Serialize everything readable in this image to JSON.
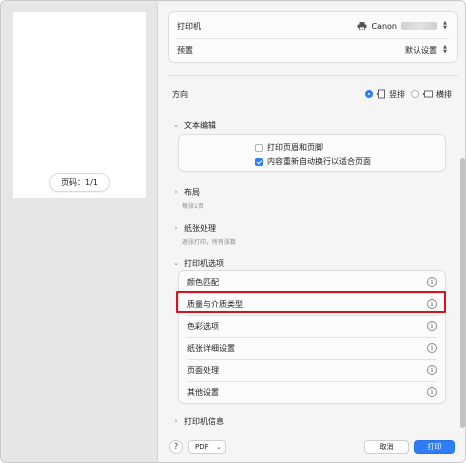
{
  "preview": {
    "page_indicator": "页码：1/1"
  },
  "top_card": {
    "printer_label": "打印机",
    "printer_value": "Canon",
    "preset_label": "预置",
    "preset_value": "默认设置"
  },
  "orientation": {
    "label": "方向",
    "options": [
      "竖排",
      "横排"
    ],
    "selected": "竖排"
  },
  "text_edit": {
    "title": "文本编辑",
    "options": [
      {
        "label": "打印页眉和页脚",
        "checked": false
      },
      {
        "label": "内容重新自动换行以适合页面",
        "checked": true
      }
    ]
  },
  "layout": {
    "title": "布局",
    "summary": "每张1页"
  },
  "paper_handling": {
    "title": "纸张处理",
    "summary": "逐张打印，所有张数"
  },
  "printer_options": {
    "title": "打印机选项",
    "items": [
      "颜色匹配",
      "质量与介质类型",
      "色彩选项",
      "纸张详细设置",
      "页面处理",
      "其他设置"
    ],
    "highlighted": "质量与介质类型"
  },
  "printer_info": {
    "title": "打印机信息"
  },
  "bottom": {
    "help": "?",
    "pdf": "PDF",
    "cancel": "取消",
    "print": "打印"
  },
  "colors": {
    "accent": "#2f7cf6",
    "highlight": "#d9131b"
  }
}
